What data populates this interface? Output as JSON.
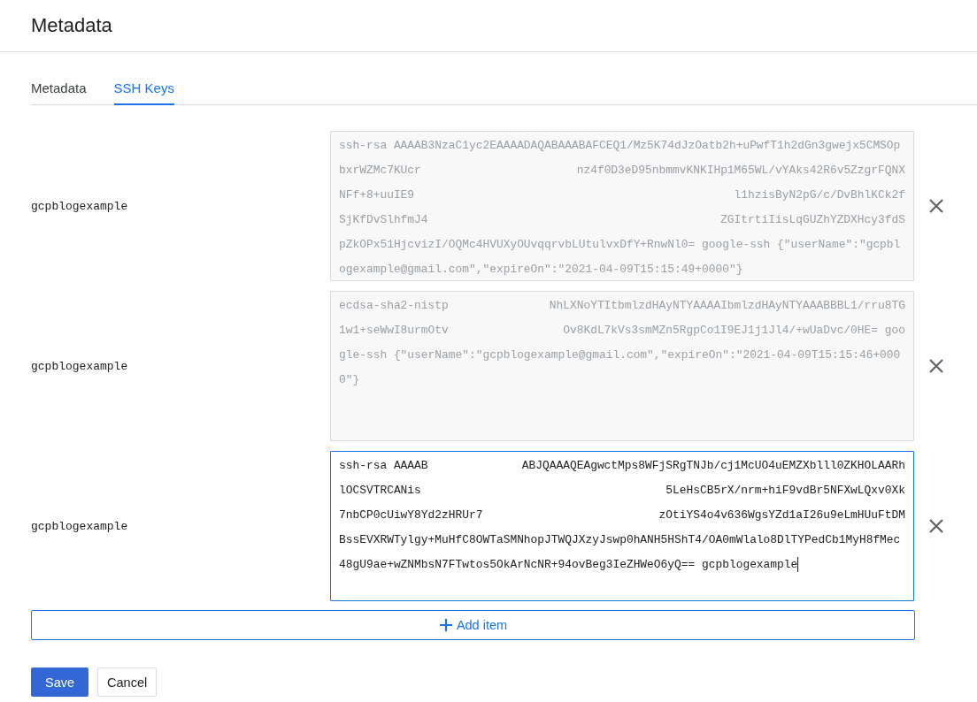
{
  "header": {
    "title": "Metadata"
  },
  "tabs": [
    {
      "label": "Metadata",
      "selected": false
    },
    {
      "label": "SSH Keys",
      "selected": true
    }
  ],
  "keys": [
    {
      "username": "gcpblogexample",
      "disabled": true,
      "focused": false,
      "lines": [
        [
          "ssh-rsa AAAAB3NzaC1yc2EAAAADAQABAAABAFCEQ1/Mz5K74dJzOatb2h+uPwfT1h2dGn3gwejx5CMSOp"
        ],
        [
          "bxrWZMc7KUcr",
          "nz4f0D3eD95nbmmvKNKIHp1M65WL/vYAks42R6v5ZzgrFQNX"
        ],
        [
          "NFf+8+uuIE9",
          "l1hzisByN2pG/c/DvBhlKCk2f"
        ],
        [
          "SjKfDvSlhfmJ4",
          "ZGItrtiIisLqGUZhYZDXHcy3fdS"
        ],
        [
          "pZkOPx51HjcvizI/OQMc4HVUXyOUvqqrvbLUtulvxDfY+RnwNl0= google-ssh {\"userName\":\"gcpbl"
        ],
        [
          "ogexample@gmail.com\",\"expireOn\":\"2021-04-09T15:15:49+0000\"}"
        ]
      ]
    },
    {
      "username": "gcpblogexample",
      "disabled": true,
      "focused": false,
      "lines": [
        [
          "ecdsa-sha2-nistp",
          "NhLXNoYTItbmlzdHAyNTYAAAAIbmlzdHAyNTYAAABBBL1/rru8TG"
        ],
        [
          "1w1+seWwI8urmOtv",
          "Ov8KdL7kVs3smMZn5RgpCo1I9EJ1j1Jl4/+wUaDvc/0HE= goo"
        ],
        [
          "gle-ssh {\"userName\":\"gcpblogexample@gmail.com\",\"expireOn\":\"2021-04-09T15:15:46+000"
        ],
        [
          "0\"}"
        ]
      ]
    },
    {
      "username": "gcpblogexample",
      "disabled": false,
      "focused": true,
      "lines": [
        [
          "ssh-rsa AAAAB",
          "ABJQAAAQEAgwctMps8WFjSRgTNJb/cj1McUO4uEMZXblll0ZKHOLAARh"
        ],
        [
          "lOCSVTRCANis",
          "5LeHsCB5rX/nrm+hiF9vdBr5NFXwLQxv0Xk"
        ],
        [
          "7nbCP0cUiwY8Yd2zHRUr7",
          "zOtiYS4o4v636WgsYZd1aI26u9eLmHUuFtDM"
        ],
        [
          "BssEVXRWTylgy+MuHfC8OWTaSMNhopJTWQJXzyJswp0hANH5HShT4/OA0mWlalo8DlTYPedCb1MyH8fMec"
        ],
        [
          "48gU9ae+wZNMbsN7FTwtos5OkArNcNR+94ovBeg3IeZHWeO6yQ== gcpblogexample"
        ]
      ]
    }
  ],
  "add_button": "Add item",
  "buttons": {
    "save": "Save",
    "cancel": "Cancel"
  }
}
